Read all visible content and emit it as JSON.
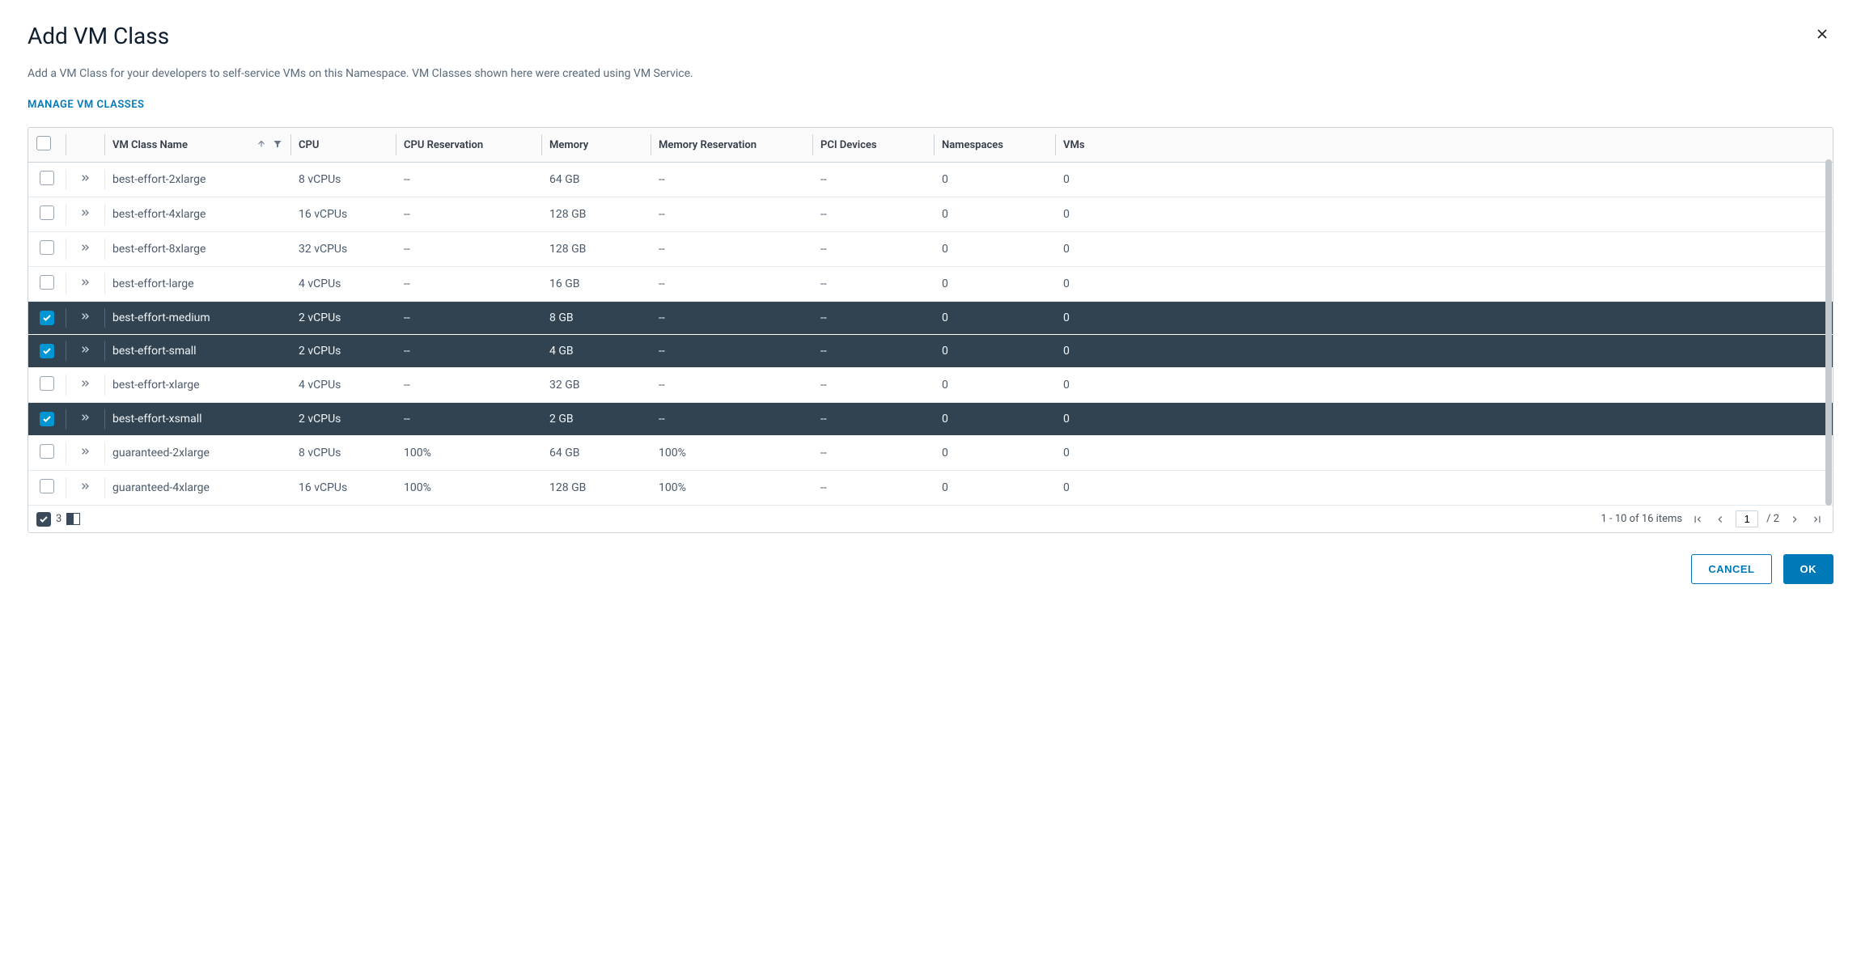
{
  "header": {
    "title": "Add VM Class"
  },
  "description": "Add a VM Class for your developers to self-service VMs on this Namespace. VM Classes shown here were created using VM Service.",
  "manage_link": "MANAGE VM CLASSES",
  "columns": {
    "name": "VM Class Name",
    "cpu": "CPU",
    "cpu_res": "CPU Reservation",
    "memory": "Memory",
    "memory_res": "Memory Reservation",
    "pci": "PCI Devices",
    "namespaces": "Namespaces",
    "vms": "VMs"
  },
  "rows": [
    {
      "selected": false,
      "name": "best-effort-2xlarge",
      "cpu": "8 vCPUs",
      "cpu_res": "--",
      "memory": "64 GB",
      "memory_res": "--",
      "pci": "--",
      "namespaces": "0",
      "vms": "0"
    },
    {
      "selected": false,
      "name": "best-effort-4xlarge",
      "cpu": "16 vCPUs",
      "cpu_res": "--",
      "memory": "128 GB",
      "memory_res": "--",
      "pci": "--",
      "namespaces": "0",
      "vms": "0"
    },
    {
      "selected": false,
      "name": "best-effort-8xlarge",
      "cpu": "32 vCPUs",
      "cpu_res": "--",
      "memory": "128 GB",
      "memory_res": "--",
      "pci": "--",
      "namespaces": "0",
      "vms": "0"
    },
    {
      "selected": false,
      "name": "best-effort-large",
      "cpu": "4 vCPUs",
      "cpu_res": "--",
      "memory": "16 GB",
      "memory_res": "--",
      "pci": "--",
      "namespaces": "0",
      "vms": "0"
    },
    {
      "selected": true,
      "name": "best-effort-medium",
      "cpu": "2 vCPUs",
      "cpu_res": "--",
      "memory": "8 GB",
      "memory_res": "--",
      "pci": "--",
      "namespaces": "0",
      "vms": "0"
    },
    {
      "selected": true,
      "name": "best-effort-small",
      "cpu": "2 vCPUs",
      "cpu_res": "--",
      "memory": "4 GB",
      "memory_res": "--",
      "pci": "--",
      "namespaces": "0",
      "vms": "0"
    },
    {
      "selected": false,
      "name": "best-effort-xlarge",
      "cpu": "4 vCPUs",
      "cpu_res": "--",
      "memory": "32 GB",
      "memory_res": "--",
      "pci": "--",
      "namespaces": "0",
      "vms": "0"
    },
    {
      "selected": true,
      "name": "best-effort-xsmall",
      "cpu": "2 vCPUs",
      "cpu_res": "--",
      "memory": "2 GB",
      "memory_res": "--",
      "pci": "--",
      "namespaces": "0",
      "vms": "0"
    },
    {
      "selected": false,
      "name": "guaranteed-2xlarge",
      "cpu": "8 vCPUs",
      "cpu_res": "100%",
      "memory": "64 GB",
      "memory_res": "100%",
      "pci": "--",
      "namespaces": "0",
      "vms": "0"
    },
    {
      "selected": false,
      "name": "guaranteed-4xlarge",
      "cpu": "16 vCPUs",
      "cpu_res": "100%",
      "memory": "128 GB",
      "memory_res": "100%",
      "pci": "--",
      "namespaces": "0",
      "vms": "0"
    }
  ],
  "footer": {
    "selected_count": "3",
    "range_text": "1 - 10 of 16 items",
    "current_page": "1",
    "total_pages_text": "/ 2"
  },
  "buttons": {
    "cancel": "CANCEL",
    "ok": "OK"
  }
}
